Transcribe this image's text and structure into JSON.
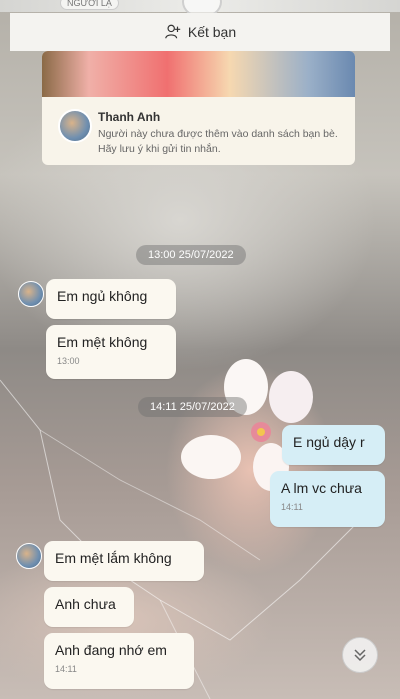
{
  "header": {
    "stranger_tag": "NGƯỜI LẠ",
    "add_friend_label": "Kết bạn"
  },
  "profile_card": {
    "name": "Thanh Anh",
    "note": "Người này chưa được thêm vào danh sách bạn bè. Hãy lưu ý khi gửi tin nhắn."
  },
  "messages": {
    "time1": "13:00 25/07/2022",
    "m1": "Em ngủ không",
    "m2": "Em mệt không",
    "m2_time": "13:00",
    "time2": "14:11 25/07/2022",
    "m3": "E ngủ dậy r",
    "m4": "A lm vc chưa",
    "m4_time": "14:11",
    "m5": "Em mệt lắm không",
    "m6": "Anh chưa",
    "m7": "Anh đang nhớ em",
    "m7_time": "14:11"
  },
  "icons": {
    "add_friend": "person-plus-icon",
    "scroll": "double-chevron-down-icon"
  },
  "colors": {
    "incoming_bubble": "#fbf8f0",
    "outgoing_bubble": "#d6eef6"
  }
}
